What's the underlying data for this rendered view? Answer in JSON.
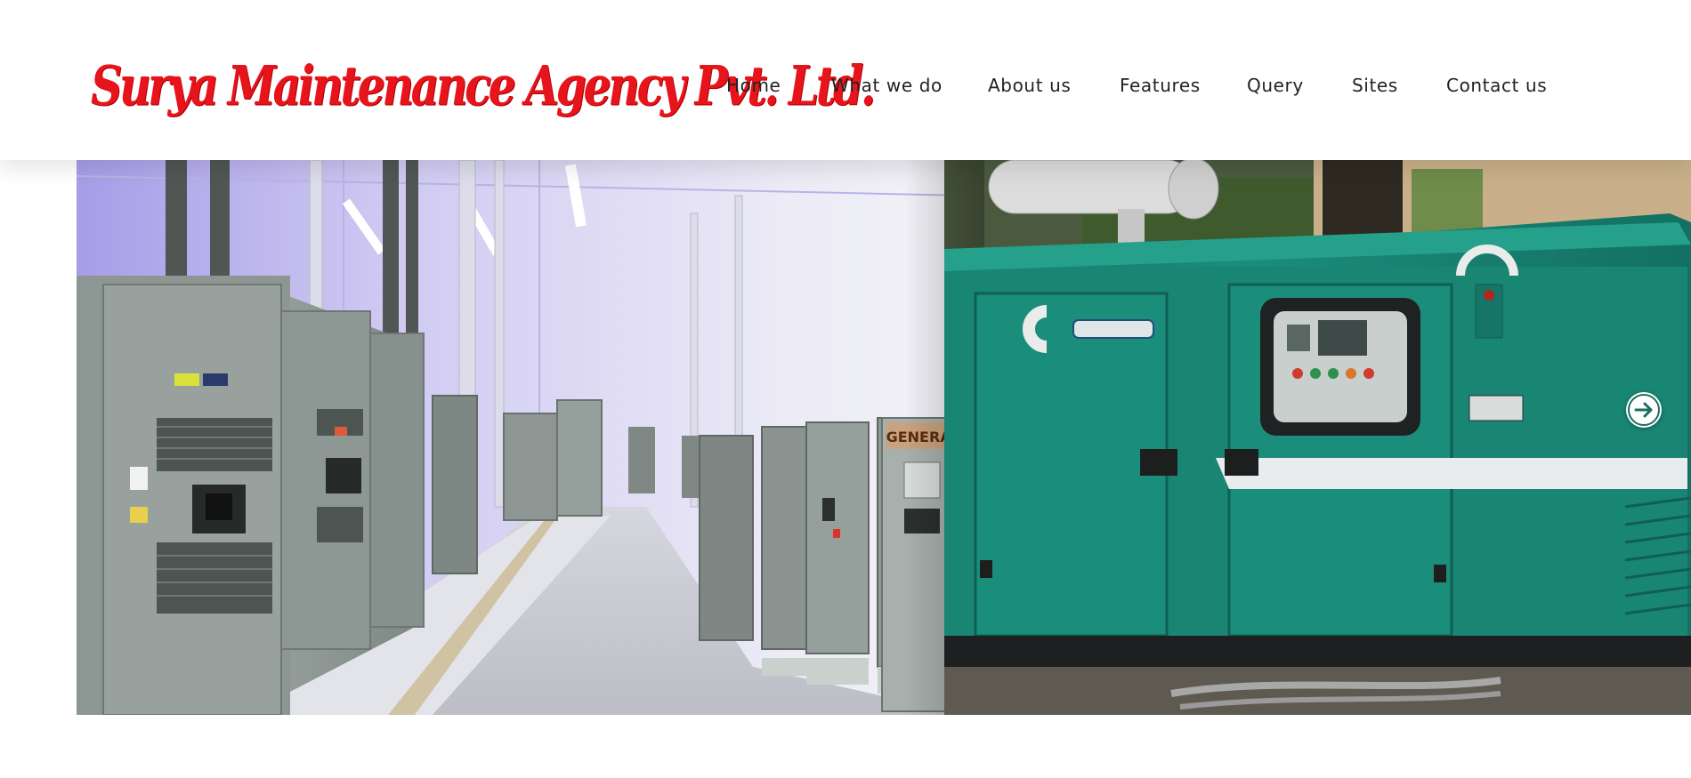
{
  "brand": {
    "logo_text": "Surya Maintenance Agency Pvt. Ltd.",
    "color": "#e8141c"
  },
  "nav": {
    "items": [
      {
        "label": "Home",
        "name": "nav-home"
      },
      {
        "label": "What we do",
        "name": "nav-what-we-do"
      },
      {
        "label": "About us",
        "name": "nav-about-us"
      },
      {
        "label": "Features",
        "name": "nav-features"
      },
      {
        "label": "Query",
        "name": "nav-query"
      },
      {
        "label": "Sites",
        "name": "nav-sites"
      },
      {
        "label": "Contact us",
        "name": "nav-contact-us"
      }
    ]
  },
  "slider": {
    "slide_image": "electrical-panels-room-and-green-diesel-generator",
    "generac_label": "GENERAC",
    "next_icon": "arrow-right-circle-icon"
  },
  "colors": {
    "nav_text": "#222222",
    "generator_green": "#1a8a78",
    "room_lavender": "#c9c4ee"
  }
}
